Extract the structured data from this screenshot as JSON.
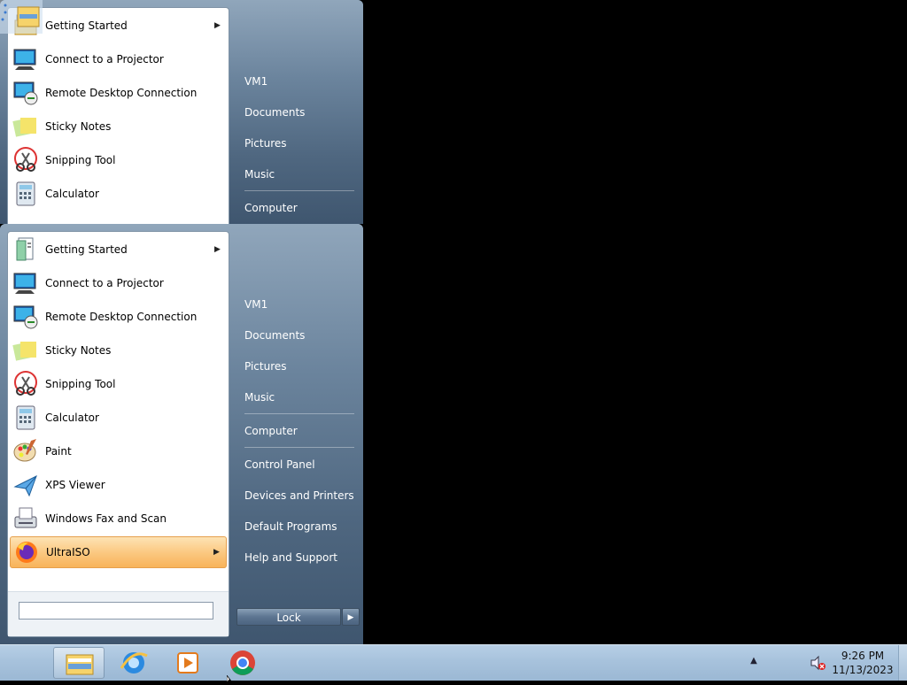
{
  "ghost_menu": {
    "programs": [
      {
        "label": "Getting Started",
        "icon": "getting-started-icon",
        "has_submenu": true
      },
      {
        "label": "Connect to a Projector",
        "icon": "projector-icon",
        "has_submenu": false
      },
      {
        "label": "Remote Desktop Connection",
        "icon": "remote-desktop-icon",
        "has_submenu": false
      },
      {
        "label": "Sticky Notes",
        "icon": "sticky-notes-icon",
        "has_submenu": false
      },
      {
        "label": "Snipping Tool",
        "icon": "snipping-tool-icon",
        "has_submenu": false
      },
      {
        "label": "Calculator",
        "icon": "calculator-icon",
        "has_submenu": false
      }
    ],
    "right_items": [
      "VM1",
      "Documents",
      "Pictures",
      "Music",
      "Computer"
    ]
  },
  "start_menu": {
    "programs": [
      {
        "label": "Getting Started",
        "icon": "getting-started-icon",
        "has_submenu": true
      },
      {
        "label": "Connect to a Projector",
        "icon": "projector-icon",
        "has_submenu": false
      },
      {
        "label": "Remote Desktop Connection",
        "icon": "remote-desktop-icon",
        "has_submenu": false
      },
      {
        "label": "Sticky Notes",
        "icon": "sticky-notes-icon",
        "has_submenu": false
      },
      {
        "label": "Snipping Tool",
        "icon": "snipping-tool-icon",
        "has_submenu": false
      },
      {
        "label": "Calculator",
        "icon": "calculator-icon",
        "has_submenu": false
      },
      {
        "label": "Paint",
        "icon": "paint-icon",
        "has_submenu": false
      },
      {
        "label": "XPS Viewer",
        "icon": "xps-viewer-icon",
        "has_submenu": false
      },
      {
        "label": "Windows Fax and Scan",
        "icon": "fax-scan-icon",
        "has_submenu": false
      },
      {
        "label": "UltraISO",
        "icon": "firefox-icon",
        "has_submenu": true,
        "highlighted": true
      }
    ],
    "search": {
      "value": "",
      "placeholder": ""
    },
    "right_items": {
      "user": "VM1",
      "documents": "Documents",
      "pictures": "Pictures",
      "music": "Music",
      "computer": "Computer",
      "control_panel": "Control Panel",
      "devices_printers": "Devices and Printers",
      "default_programs": "Default Programs",
      "help_support": "Help and Support"
    },
    "lock_label": "Lock",
    "lock_arrow": "▶"
  },
  "taskbar": {
    "pinned": [
      {
        "name": "file-explorer-icon",
        "active": true
      },
      {
        "name": "internet-explorer-icon",
        "active": false
      },
      {
        "name": "media-player-icon",
        "active": false
      },
      {
        "name": "chrome-icon",
        "active": false
      }
    ],
    "tray_arrow": "▲",
    "clock_time": "9:26 PM",
    "clock_date": "11/13/2023"
  },
  "colors": {
    "menu_gradient_top": "#90a6bb",
    "menu_gradient_bottom": "#3f566f",
    "highlight": "#fbc982",
    "taskbar": "#a7c2dc"
  }
}
